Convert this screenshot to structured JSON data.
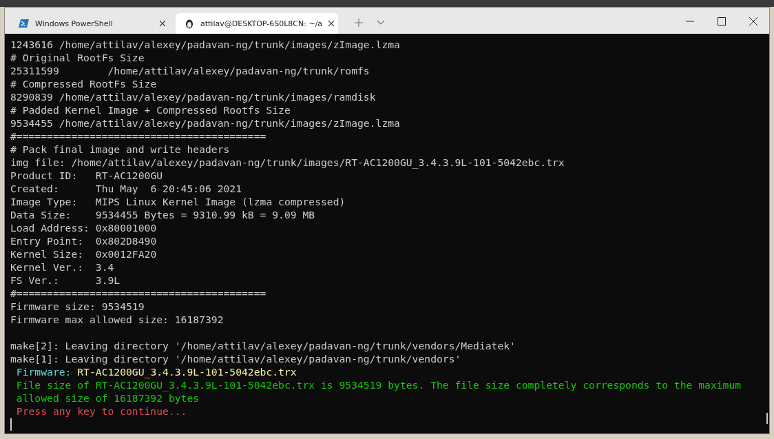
{
  "tabs": [
    {
      "title": "Windows PowerShell",
      "kind": "powershell",
      "selected": false
    },
    {
      "title": "attilav@DESKTOP-6S0L8CN: ~/a",
      "kind": "linux",
      "selected": true
    }
  ],
  "lines": [
    {
      "kind": "plain",
      "text": "1243616 /home/attilav/alexey/padavan-ng/trunk/images/zImage.lzma"
    },
    {
      "kind": "plain",
      "text": "# Original RootFs Size"
    },
    {
      "kind": "plain",
      "text": "25311599        /home/attilav/alexey/padavan-ng/trunk/romfs"
    },
    {
      "kind": "plain",
      "text": "# Compressed RootFs Size"
    },
    {
      "kind": "plain",
      "text": "8290839 /home/attilav/alexey/padavan-ng/trunk/images/ramdisk"
    },
    {
      "kind": "plain",
      "text": "# Padded Kernel Image + Compressed Rootfs Size"
    },
    {
      "kind": "plain",
      "text": "9534455 /home/attilav/alexey/padavan-ng/trunk/images/zImage.lzma"
    },
    {
      "kind": "plain",
      "text": "#========================================="
    },
    {
      "kind": "plain",
      "text": "# Pack final image and write headers"
    },
    {
      "kind": "plain",
      "text": "img file: /home/attilav/alexey/padavan-ng/trunk/images/RT-AC1200GU_3.4.3.9L-101-5042ebc.trx"
    },
    {
      "kind": "plain",
      "text": "Product ID:   RT-AC1200GU"
    },
    {
      "kind": "plain",
      "text": "Created:      Thu May  6 20:45:06 2021"
    },
    {
      "kind": "plain",
      "text": "Image Type:   MIPS Linux Kernel Image (lzma compressed)"
    },
    {
      "kind": "plain",
      "text": "Data Size:    9534455 Bytes = 9310.99 kB = 9.09 MB"
    },
    {
      "kind": "plain",
      "text": "Load Address: 0x80001000"
    },
    {
      "kind": "plain",
      "text": "Entry Point:  0x802D8490"
    },
    {
      "kind": "plain",
      "text": "Kernel Size:  0x0012FA20"
    },
    {
      "kind": "plain",
      "text": "Kernel Ver.:  3.4"
    },
    {
      "kind": "plain",
      "text": "FS Ver.:      3.9L"
    },
    {
      "kind": "plain",
      "text": "#========================================="
    },
    {
      "kind": "plain",
      "text": "Firmware size: 9534519"
    },
    {
      "kind": "plain",
      "text": "Firmware max allowed size: 16187392"
    },
    {
      "kind": "blank"
    },
    {
      "kind": "plain",
      "text": "make[2]: Leaving directory '/home/attilav/alexey/padavan-ng/trunk/vendors/Mediatek'"
    },
    {
      "kind": "plain",
      "text": "make[1]: Leaving directory '/home/attilav/alexey/padavan-ng/trunk/vendors'"
    },
    {
      "kind": "labeled",
      "label": "Firmware:",
      "text": "RT-AC1200GU_3.4.3.9L-101-5042ebc.trx"
    },
    {
      "kind": "success",
      "text": "File size of RT-AC1200GU_3.4.3.9L-101-5042ebc.trx is 9534519 bytes. The file size completely corresponds to the maximum allowed size of 16187392 bytes"
    },
    {
      "kind": "error",
      "text": "Press any key to continue..."
    }
  ]
}
